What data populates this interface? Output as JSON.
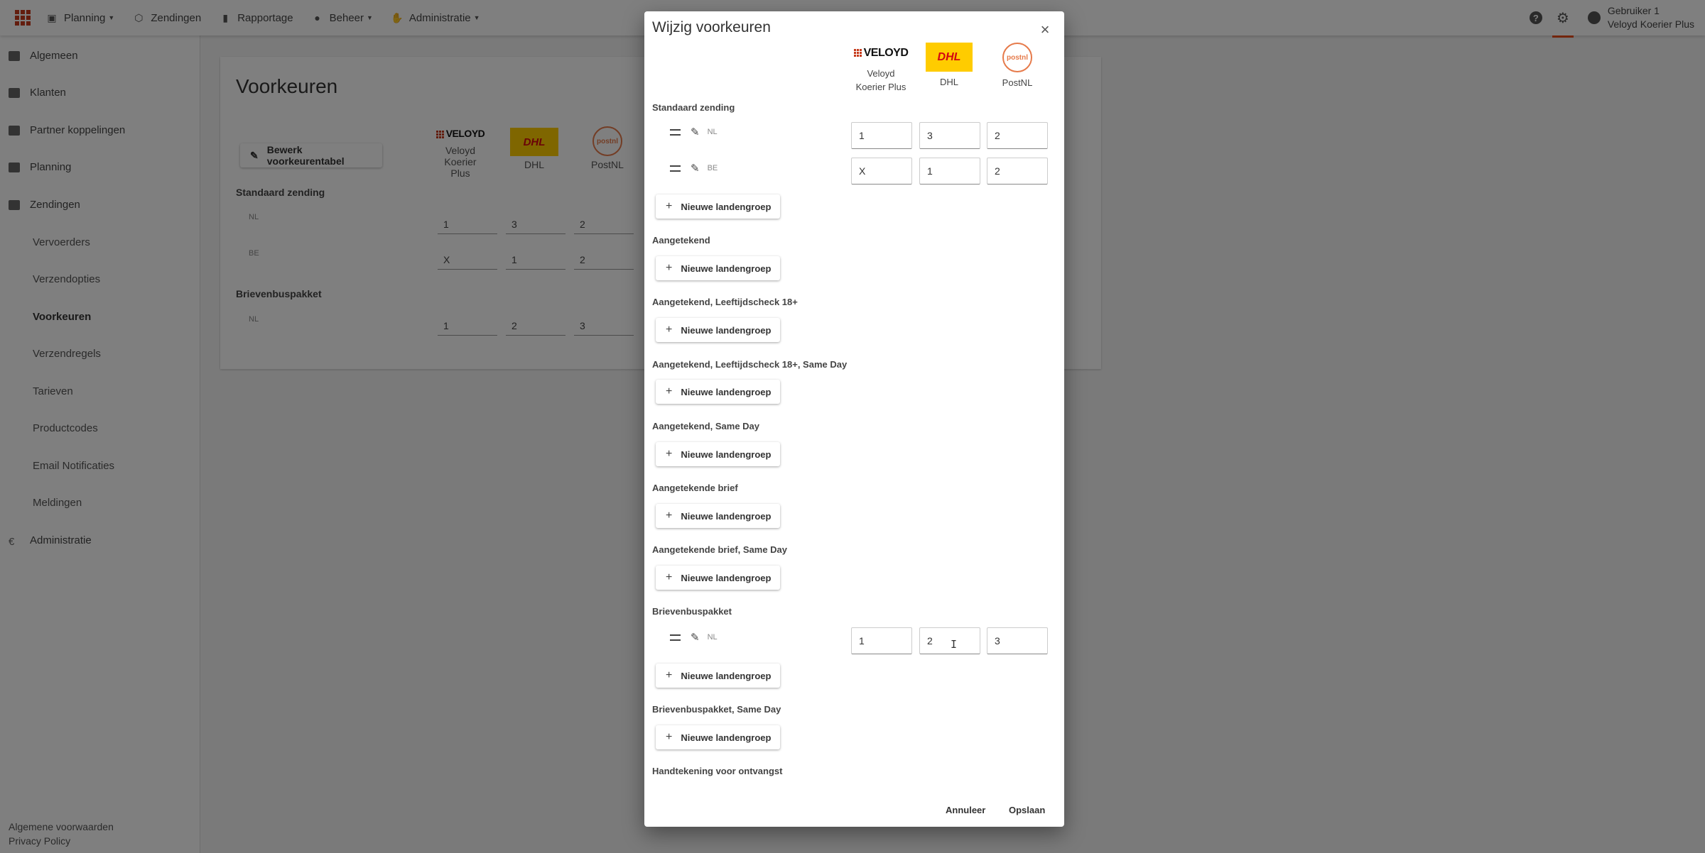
{
  "topbar": {
    "nav": [
      {
        "label": "Planning",
        "icon": "map-icon",
        "has_caret": true
      },
      {
        "label": "Zendingen",
        "icon": "box-icon",
        "has_caret": false
      },
      {
        "label": "Rapportage",
        "icon": "bar-chart-icon",
        "has_caret": false
      },
      {
        "label": "Beheer",
        "icon": "people-icon",
        "has_caret": true
      },
      {
        "label": "Administratie",
        "icon": "chart-hand-icon",
        "has_caret": true
      }
    ],
    "help_icon": "?",
    "settings_icon": "gear-icon",
    "user_line1": "Gebruiker 1",
    "user_line2": "Veloyd Koerier Plus"
  },
  "sidebar": {
    "items": [
      {
        "label": "Algemeen"
      },
      {
        "label": "Klanten"
      },
      {
        "label": "Partner koppelingen"
      },
      {
        "label": "Planning"
      },
      {
        "label": "Zendingen"
      }
    ],
    "subitems": [
      {
        "label": "Vervoerders"
      },
      {
        "label": "Verzendopties"
      },
      {
        "label": "Voorkeuren"
      },
      {
        "label": "Verzendregels"
      },
      {
        "label": "Tarieven"
      },
      {
        "label": "Productcodes"
      },
      {
        "label": "Email Notificaties"
      },
      {
        "label": "Meldingen"
      }
    ],
    "admin": "Administratie",
    "footer1": "Algemene voorwaarden",
    "footer2": "Privacy Policy"
  },
  "page": {
    "title": "Voorkeuren",
    "edit_button": "Bewerk voorkeurentabel",
    "carriers": [
      {
        "name1": "Veloyd",
        "name2": "Koerier Plus",
        "logo_text": "VELOYD"
      },
      {
        "name1": "DHL",
        "name2": "",
        "logo_text": "DHL"
      },
      {
        "name1": "PostNL",
        "name2": "",
        "logo_text": "postnl"
      }
    ],
    "sections": [
      {
        "label": "Standaard zending",
        "rows": [
          {
            "code": "NL",
            "values": [
              "1",
              "3",
              "2"
            ]
          },
          {
            "code": "BE",
            "values": [
              "X",
              "1",
              "2"
            ]
          }
        ]
      },
      {
        "label": "Brievenbuspakket",
        "rows": [
          {
            "code": "NL",
            "values": [
              "1",
              "2",
              "3"
            ]
          }
        ]
      }
    ]
  },
  "dialog": {
    "title": "Wijzig voorkeuren",
    "close": "×",
    "carriers": [
      {
        "line1": "Veloyd",
        "line2": "Koerier Plus",
        "logo_text": "VELOYD"
      },
      {
        "line1": "DHL",
        "line2": "",
        "logo_text": "DHL"
      },
      {
        "line1": "PostNL",
        "line2": "",
        "logo_text": "postnl"
      }
    ],
    "add_group_label": "Nieuwe landengroep",
    "sections": [
      {
        "label": "Standaard zending",
        "rows": [
          {
            "code": "NL",
            "values": [
              "1",
              "3",
              "2"
            ]
          },
          {
            "code": "BE",
            "values": [
              "X",
              "1",
              "2"
            ]
          }
        ]
      },
      {
        "label": "Aangetekend",
        "rows": []
      },
      {
        "label": "Aangetekend, Leeftijdscheck 18+",
        "rows": []
      },
      {
        "label": "Aangetekend, Leeftijdscheck 18+, Same Day",
        "rows": []
      },
      {
        "label": "Aangetekend, Same Day",
        "rows": []
      },
      {
        "label": "Aangetekende brief",
        "rows": []
      },
      {
        "label": "Aangetekende brief, Same Day",
        "rows": []
      },
      {
        "label": "Brievenbuspakket",
        "rows": [
          {
            "code": "NL",
            "values": [
              "1",
              "2",
              "3"
            ]
          }
        ]
      },
      {
        "label": "Brievenbuspakket, Same Day",
        "rows": []
      },
      {
        "label": "Handtekening voor ontvangst",
        "rows": []
      }
    ],
    "cancel": "Annuleer",
    "save": "Opslaan"
  },
  "colors": {
    "accent": "#e64a19",
    "veloyd_red": "#c63b1c",
    "dhl_yellow": "#ffcc00",
    "dhl_red": "#d40511",
    "postnl_orange": "#e67a4a"
  }
}
